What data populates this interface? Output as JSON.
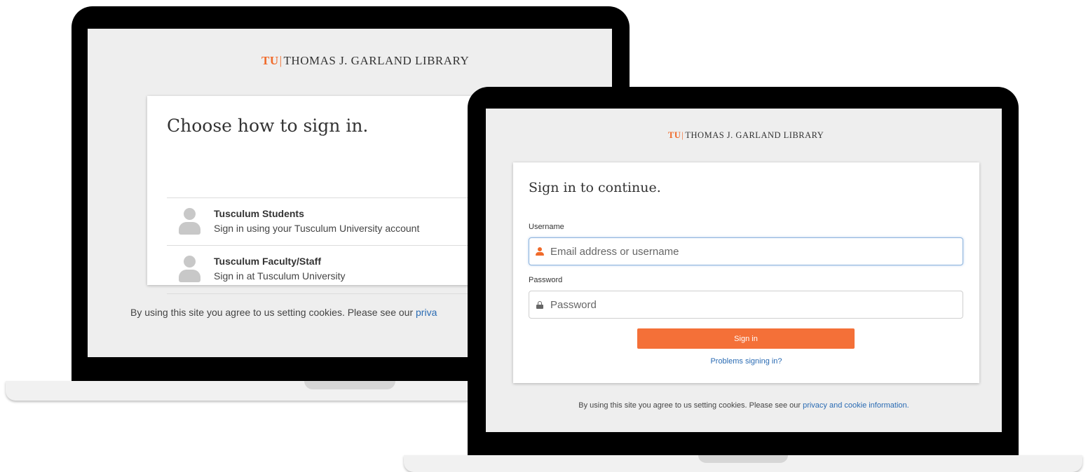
{
  "brand": {
    "mark": "TU",
    "divider": "|",
    "name": "THOMAS J. GARLAND LIBRARY"
  },
  "left_screen": {
    "title": "Choose how to sign in.",
    "options": [
      {
        "title": "Tusculum Students",
        "subtitle": "Sign in using your Tusculum University account",
        "icon": "user-avatar-icon"
      },
      {
        "title": "Tusculum Faculty/Staff",
        "subtitle": "Sign in at Tusculum University",
        "icon": "user-avatar-icon"
      }
    ],
    "cookie_text": "By using this site you agree to us setting cookies. Please see our ",
    "cookie_link": "priva"
  },
  "right_screen": {
    "title": "Sign in to continue.",
    "username": {
      "label": "Username",
      "placeholder": "Email address or username",
      "value": "",
      "icon": "user-icon"
    },
    "password": {
      "label": "Password",
      "placeholder": "Password",
      "value": "",
      "icon": "lock-icon"
    },
    "signin_label": "Sign in",
    "problems_link": "Problems signing in?",
    "cookie_text": "By using this site you agree to us setting cookies. Please see our ",
    "cookie_link": "privacy and cookie information."
  },
  "colors": {
    "accent": "#f47038",
    "link": "#2a6bb3",
    "screen_bg": "#eeeeee",
    "bezel": "#000000"
  }
}
